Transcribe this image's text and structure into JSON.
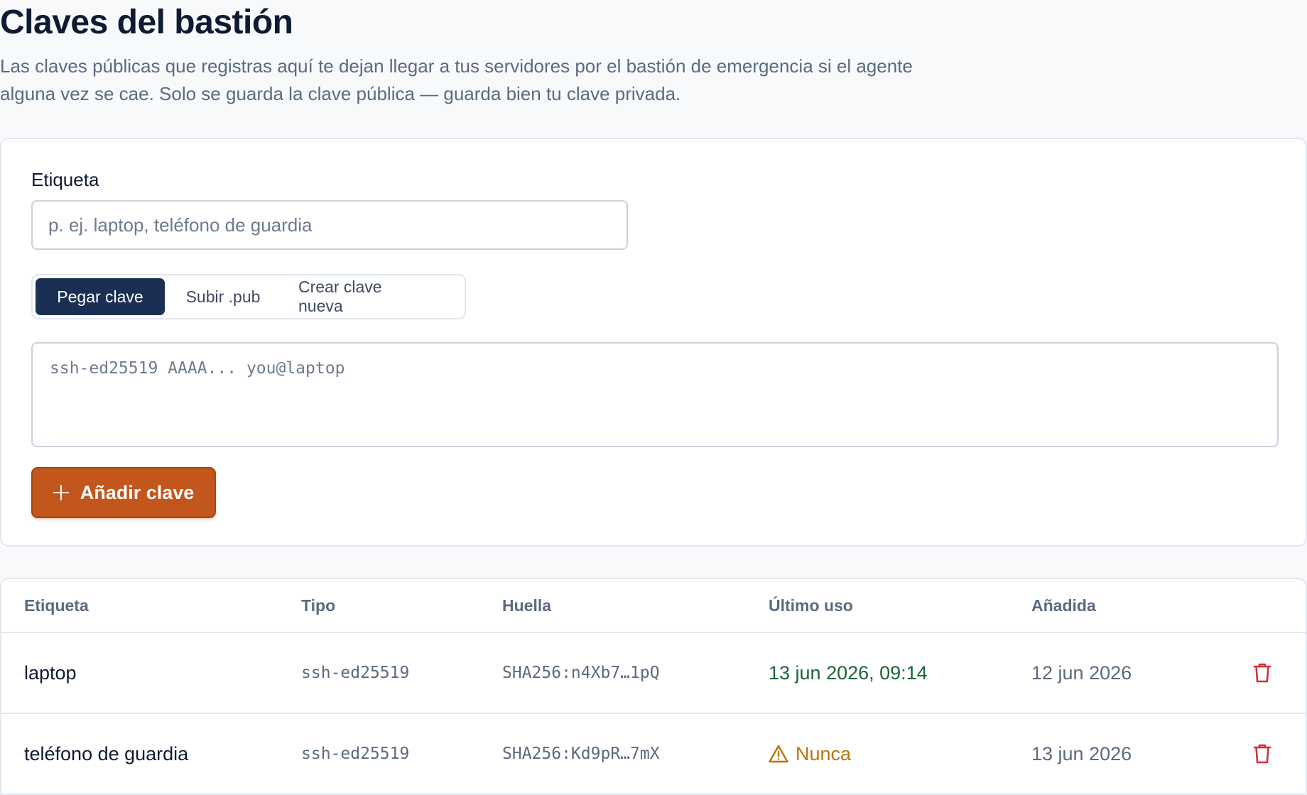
{
  "header": {
    "title": "Claves del bastión",
    "subtitle": "Las claves públicas que registras aquí te dejan llegar a tus servidores por el bastión de emergencia si el agente alguna vez se cae. Solo se guarda la clave pública — guarda bien tu clave privada."
  },
  "form": {
    "label_field": {
      "label": "Etiqueta",
      "value": "",
      "placeholder": "p. ej. laptop, teléfono de guardia"
    },
    "tabs": [
      {
        "label": "Pegar clave",
        "active": true
      },
      {
        "label": "Subir .pub",
        "active": false
      },
      {
        "label": "Crear clave nueva",
        "active": false
      }
    ],
    "key_field": {
      "value": "",
      "placeholder": "ssh-ed25519 AAAA... you@laptop"
    },
    "add_button": {
      "label": "Añadir clave",
      "icon": "plus-icon"
    }
  },
  "table": {
    "columns": [
      "Etiqueta",
      "Tipo",
      "Huella",
      "Último uso",
      "Añadida"
    ],
    "rows": [
      {
        "label": "laptop",
        "type": "ssh-ed25519",
        "fingerprint": "SHA256:n4Xb7…1pQ",
        "last_used": "13 jun 2026, 09:14",
        "last_used_status": "recent",
        "added": "12 jun 2026",
        "delete_icon": "trash-icon"
      },
      {
        "label": "teléfono de guardia",
        "type": "ssh-ed25519",
        "fingerprint": "SHA256:Kd9pR…7mX",
        "last_used": "Nunca",
        "last_used_status": "never",
        "last_used_icon": "warning-icon",
        "added": "13 jun 2026",
        "delete_icon": "trash-icon"
      }
    ]
  },
  "colors": {
    "primary_dark": "#1b2f52",
    "accent_orange": "#c2561c",
    "success_green": "#17663a",
    "warning_amber": "#b8740d",
    "danger_red": "#d42f3a"
  }
}
